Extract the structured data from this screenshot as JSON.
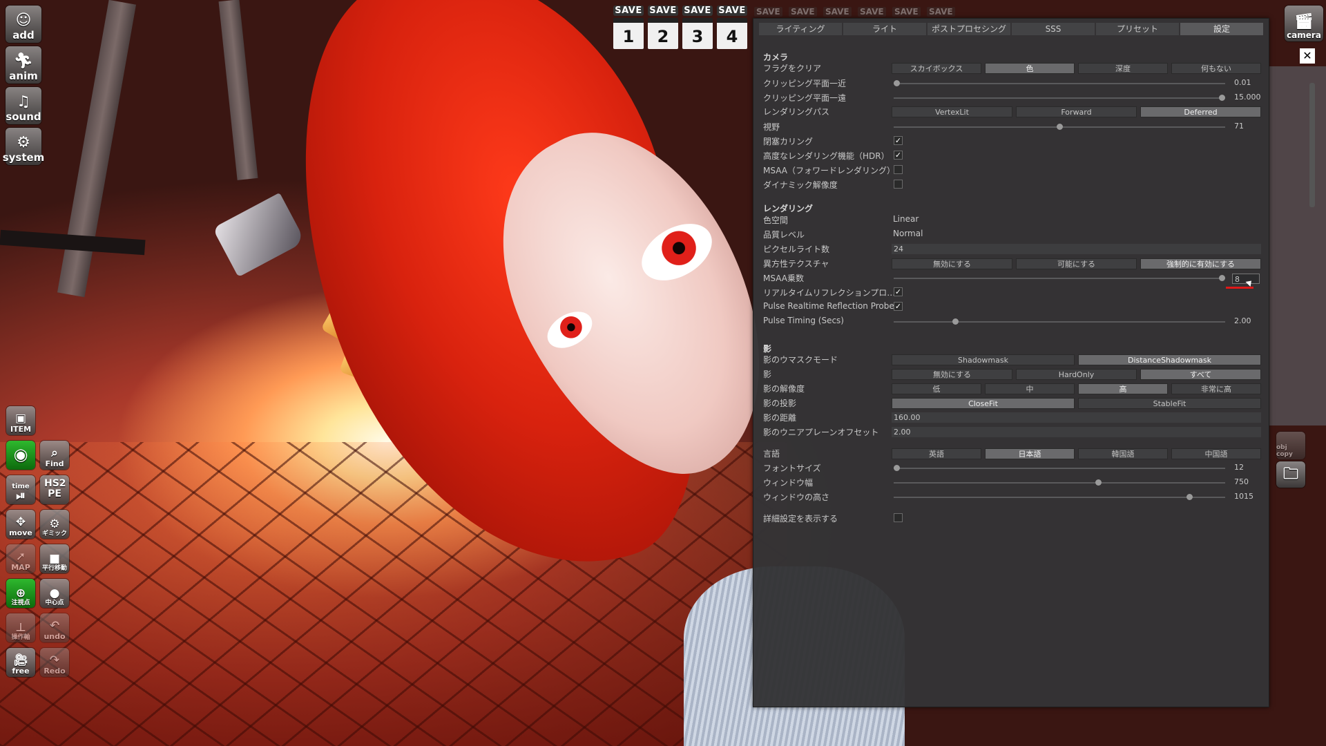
{
  "toolbar_left": {
    "add": "add",
    "anim": "anim",
    "sound": "sound",
    "system": "system",
    "item": "ITEM",
    "find": "Find",
    "time": "time",
    "hs2pe": "HS2 PE",
    "move": "move",
    "gimmick": "ギミック",
    "map": "MAP",
    "translate": "平行移動",
    "focus": "注視点",
    "center": "中心点",
    "axis": "操作軸",
    "undo": "undo",
    "free": "free",
    "redo": "Redo"
  },
  "save_slots": [
    {
      "label": "SAVE",
      "number": "1"
    },
    {
      "label": "SAVE",
      "number": "2"
    },
    {
      "label": "SAVE",
      "number": "3"
    },
    {
      "label": "SAVE",
      "number": "4"
    }
  ],
  "save_ghost": "SAVE",
  "camera_button": "camera",
  "close_icon": "✕",
  "objcopy": "obj copy",
  "tabs": [
    "ライティング",
    "ライト",
    "ポストプロセシング",
    "SSS",
    "プリセット",
    "設定"
  ],
  "camera": {
    "title": "カメラ",
    "clear_flags": {
      "label": "フラグをクリア",
      "options": [
        "スカイボックス",
        "色",
        "深度",
        "何もない"
      ],
      "selected": 1
    },
    "clip_near": {
      "label": "クリッピング平面一近",
      "value": "0.01",
      "fraction": 0.0
    },
    "clip_far": {
      "label": "クリッピング平面一遠",
      "value": "15.000",
      "fraction": 1.0
    },
    "render_path": {
      "label": "レンダリングパス",
      "options": [
        "VertexLit",
        "Forward",
        "Deferred"
      ],
      "selected": 2
    },
    "fov": {
      "label": "視野",
      "value": "71",
      "fraction": 0.5
    },
    "occlusion": {
      "label": "閉塞カリング",
      "checked": true
    },
    "hdr": {
      "label": "高度なレンダリング機能（HDR）",
      "checked": true
    },
    "msaa": {
      "label": "MSAA（フォワードレンダリング）",
      "checked": false
    },
    "dynamic_res": {
      "label": "ダイナミック解像度",
      "checked": false
    }
  },
  "rendering": {
    "title": "レンダリング",
    "color_space": {
      "label": "色空間",
      "value": "Linear"
    },
    "quality": {
      "label": "品質レベル",
      "value": "Normal"
    },
    "pixel_lights": {
      "label": "ピクセルライト数",
      "value": "24"
    },
    "aniso": {
      "label": "異方性テクスチャ",
      "options": [
        "無効にする",
        "可能にする",
        "強制的に有効にする"
      ],
      "selected": 2
    },
    "msaa_mult": {
      "label": "MSAA乗数",
      "value": "8",
      "fraction": 1.0
    },
    "realtime_reflect": {
      "label": "リアルタイムリフレクションプロ…",
      "checked": true
    },
    "pulse_probes": {
      "label": "Pulse Realtime Reflection Probes",
      "checked": true
    },
    "pulse_timing": {
      "label": "Pulse Timing (Secs)",
      "value": "2.00",
      "fraction": 0.18
    }
  },
  "shadow": {
    "title": "影",
    "mask_mode": {
      "label": "影のウマスクモード",
      "options": [
        "Shadowmask",
        "DistanceShadowmask"
      ],
      "selected": 1
    },
    "shadows": {
      "label": "影",
      "options": [
        "無効にする",
        "HardOnly",
        "すべて"
      ],
      "selected": 2
    },
    "resolution": {
      "label": "影の解像度",
      "options": [
        "低",
        "中",
        "高",
        "非常に高"
      ],
      "selected": 2
    },
    "projection": {
      "label": "影の投影",
      "options": [
        "CloseFit",
        "StableFit"
      ],
      "selected": 0
    },
    "distance": {
      "label": "影の距離",
      "value": "160.00"
    },
    "near_plane": {
      "label": "影のウニアプレーンオフセット",
      "value": "2.00"
    }
  },
  "general": {
    "language": {
      "label": "言語",
      "options": [
        "英語",
        "日本語",
        "韓国語",
        "中国語"
      ],
      "selected": 1
    },
    "font_size": {
      "label": "フォントサイズ",
      "value": "12",
      "fraction": 0.0
    },
    "window_width": {
      "label": "ウィンドウ幅",
      "value": "750",
      "fraction": 0.62
    },
    "window_height": {
      "label": "ウィンドウの高さ",
      "value": "1015",
      "fraction": 0.9
    },
    "advanced": {
      "label": "詳細設定を表示する",
      "checked": false
    }
  },
  "colors": {
    "panel": "#343436",
    "button_on": "#6a6a6c",
    "accent_red": "#e01818",
    "toolbar_green": "#2eb82e"
  }
}
